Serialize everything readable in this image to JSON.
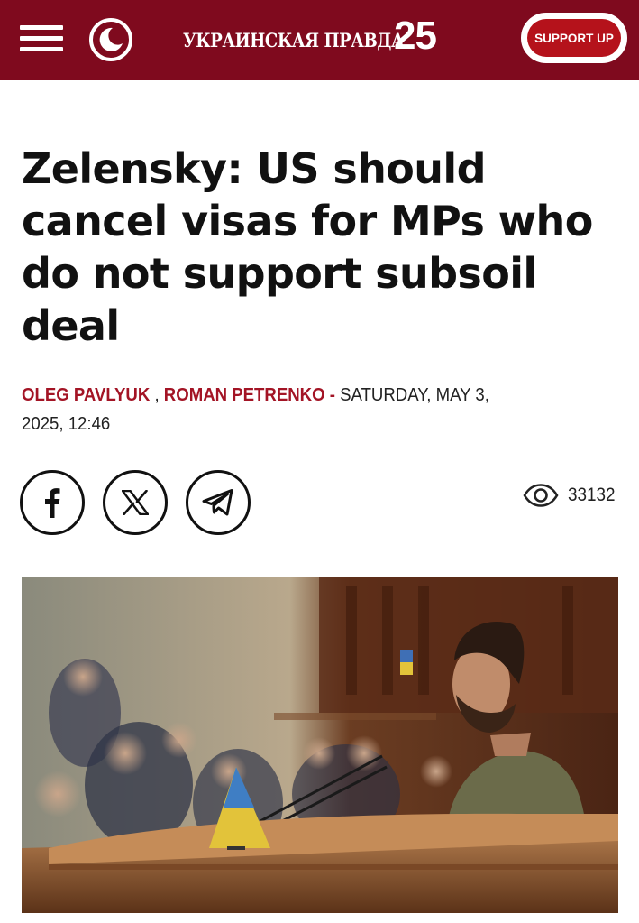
{
  "header": {
    "logo_text": "УКРАИНСКАЯ ПРАВДА",
    "logo_number": "25",
    "support_label": "SUPPORT UP",
    "menu_icon": "hamburger-menu-icon",
    "theme_icon": "crescent-moon-icon",
    "background_color": "#7f0a1e",
    "support_color": "#b5121b"
  },
  "article": {
    "title": "Zelensky: US should cancel visas for MPs who do not support subsoil deal",
    "authors": [
      "OLEG PAVLYUK",
      "ROMAN PETRENKO"
    ],
    "author_separator": ",",
    "date_separator": "-",
    "date_line1": "SATURDAY, MAY 3,",
    "date_line2": "2025, 12:46",
    "author_color": "#a31425"
  },
  "share": {
    "items": [
      {
        "icon": "facebook-icon"
      },
      {
        "icon": "x-icon"
      },
      {
        "icon": "telegram-icon"
      }
    ]
  },
  "stats": {
    "views_icon": "eye-icon",
    "views": "33132"
  },
  "photo": {
    "icon": "article-photo"
  }
}
